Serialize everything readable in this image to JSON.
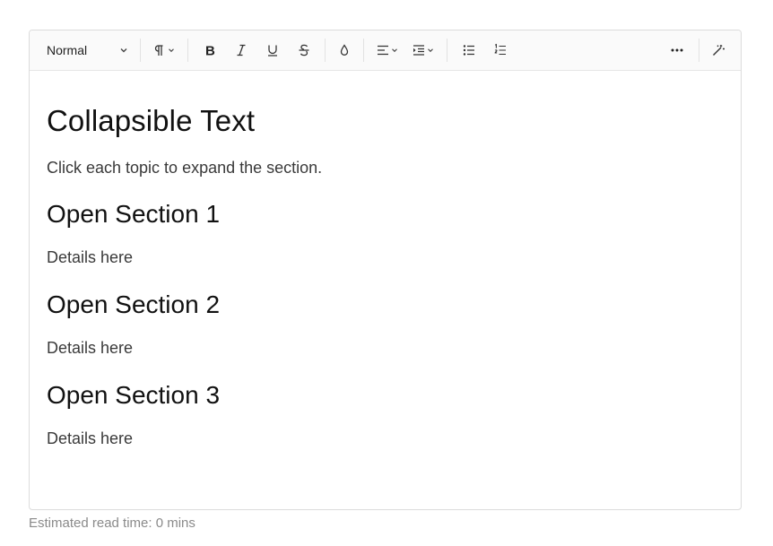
{
  "toolbar": {
    "block_type": "Normal",
    "buttons": [
      "paragraph",
      "bold",
      "italic",
      "underline",
      "strikethrough",
      "color",
      "align",
      "indent",
      "bulleted-list",
      "numbered-list",
      "more",
      "ai-assist"
    ]
  },
  "document": {
    "title": "Collapsible Text",
    "intro": "Click each topic to expand the section.",
    "sections": [
      {
        "heading": "Open Section 1",
        "body": "Details here"
      },
      {
        "heading": "Open Section 2",
        "body": "Details here"
      },
      {
        "heading": "Open Section 3",
        "body": "Details here"
      }
    ]
  },
  "footer": {
    "read_time": "Estimated read time: 0 mins"
  }
}
